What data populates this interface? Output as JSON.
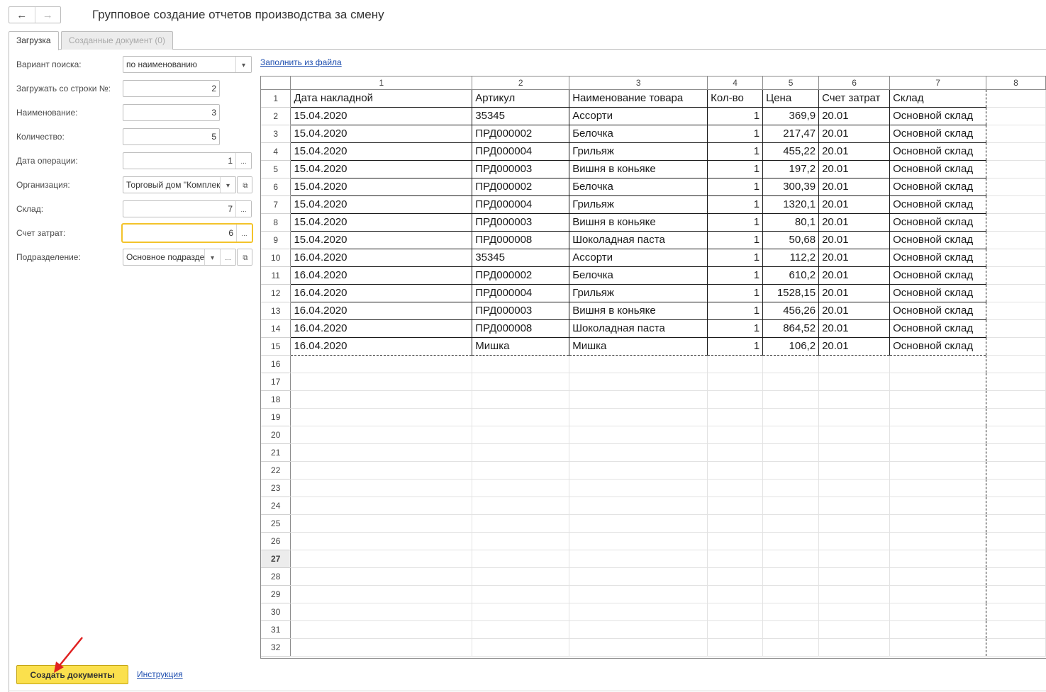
{
  "window": {
    "title": "Групповое создание отчетов производства за смену",
    "back_icon": "←",
    "forward_icon": "→"
  },
  "tabs": [
    {
      "label": "Загрузка",
      "active": true
    },
    {
      "label": "Созданные документ (0)",
      "active": false
    }
  ],
  "form": {
    "search_variant": {
      "label": "Вариант поиска:",
      "value": "по наименованию"
    },
    "start_row": {
      "label": "Загружать со строки №:",
      "value": "2"
    },
    "name": {
      "label": "Наименование:",
      "value": "3"
    },
    "quantity": {
      "label": "Количество:",
      "value": "5"
    },
    "operation_date": {
      "label": "Дата операции:",
      "value": "1"
    },
    "organization": {
      "label": "Организация:",
      "value": "Торговый дом \"Комплексный\""
    },
    "warehouse": {
      "label": "Склад:",
      "value": "7"
    },
    "cost_account": {
      "label": "Счет затрат:",
      "value": "6"
    },
    "department": {
      "label": "Подразделение:",
      "value": "Основное подразделение"
    }
  },
  "fill_from_file_link": "Заполнить из файла",
  "sheet": {
    "column_headers": [
      "1",
      "2",
      "3",
      "4",
      "5",
      "6",
      "7",
      "8"
    ],
    "header_row": [
      "Дата накладной",
      "Артикул",
      "Наименование товара",
      "Кол-во",
      "Цена",
      "Счет затрат",
      "Склад"
    ],
    "rows": [
      [
        "15.04.2020",
        "35345",
        "Ассорти",
        "1",
        "369,9",
        "20.01",
        "Основной склад"
      ],
      [
        "15.04.2020",
        "ПРД000002",
        "Белочка",
        "1",
        "217,47",
        "20.01",
        "Основной склад"
      ],
      [
        "15.04.2020",
        "ПРД000004",
        "Грильяж",
        "1",
        "455,22",
        "20.01",
        "Основной склад"
      ],
      [
        "15.04.2020",
        "ПРД000003",
        "Вишня в коньяке",
        "1",
        "197,2",
        "20.01",
        "Основной склад"
      ],
      [
        "15.04.2020",
        "ПРД000002",
        "Белочка",
        "1",
        "300,39",
        "20.01",
        "Основной склад"
      ],
      [
        "15.04.2020",
        "ПРД000004",
        "Грильяж",
        "1",
        "1320,1",
        "20.01",
        "Основной склад"
      ],
      [
        "15.04.2020",
        "ПРД000003",
        "Вишня в коньяке",
        "1",
        "80,1",
        "20.01",
        "Основной склад"
      ],
      [
        "15.04.2020",
        "ПРД000008",
        "Шоколадная паста",
        "1",
        "50,68",
        "20.01",
        "Основной склад"
      ],
      [
        "16.04.2020",
        "35345",
        "Ассорти",
        "1",
        "112,2",
        "20.01",
        "Основной склад"
      ],
      [
        "16.04.2020",
        "ПРД000002",
        "Белочка",
        "1",
        "610,2",
        "20.01",
        "Основной склад"
      ],
      [
        "16.04.2020",
        "ПРД000004",
        "Грильяж",
        "1",
        "1528,15",
        "20.01",
        "Основной склад"
      ],
      [
        "16.04.2020",
        "ПРД000003",
        "Вишня в коньяке",
        "1",
        "456,26",
        "20.01",
        "Основной склад"
      ],
      [
        "16.04.2020",
        "ПРД000008",
        "Шоколадная паста",
        "1",
        "864,52",
        "20.01",
        "Основной склад"
      ],
      [
        "16.04.2020",
        "Мишка",
        "Мишка",
        "1",
        "106,2",
        "20.01",
        "Основной склад"
      ]
    ],
    "row_numbers": [
      "1",
      "2",
      "3",
      "4",
      "5",
      "6",
      "7",
      "8",
      "9",
      "10",
      "11",
      "12",
      "13",
      "14",
      "15",
      "16",
      "17",
      "18",
      "19",
      "20",
      "21",
      "22",
      "23",
      "24",
      "25",
      "26",
      "27",
      "28",
      "29",
      "30",
      "31",
      "32"
    ],
    "selected_row_number": "27"
  },
  "footer": {
    "create_button": "Создать документы",
    "instruction_link": "Инструкция"
  },
  "colors": {
    "accent_yellow": "#fbe04d",
    "focus_border": "#f3c32b",
    "link_blue": "#1f4fb0",
    "annotation_arrow": "#e02020"
  },
  "icons": {
    "dropdown": "▾",
    "ellipsis": "...",
    "open": "⧉"
  }
}
